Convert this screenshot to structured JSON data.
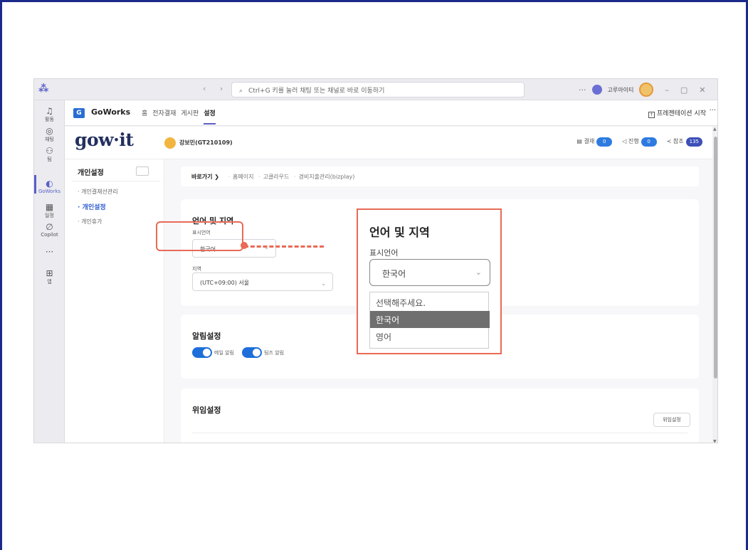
{
  "titlebar": {
    "search_placeholder": "Ctrl+G 키를 눌러 채팅 또는 채널로 바로 이동하기",
    "user_name": "고루아이티",
    "more": "···"
  },
  "rail": {
    "items": [
      {
        "icon": "bell-icon",
        "label": "활동"
      },
      {
        "icon": "chat-icon",
        "label": "채팅"
      },
      {
        "icon": "teams-icon",
        "label": "팀"
      },
      {
        "icon": "goworks-icon",
        "label": "GoWorks"
      },
      {
        "icon": "calendar-icon",
        "label": "일정"
      },
      {
        "icon": "copilot-icon",
        "label": "Copilot"
      },
      {
        "icon": "more-icon",
        "label": "···"
      },
      {
        "icon": "apps-icon",
        "label": "앱"
      }
    ]
  },
  "app_header": {
    "logo_letter": "G",
    "app_name": "GoWorks",
    "tabs": [
      "홈",
      "전자결재",
      "게시판",
      "설정"
    ],
    "active_tab": "설정",
    "present_label": "프레젠테이션 시작",
    "more": "···"
  },
  "gowit_header": {
    "logo": "gow·it",
    "user": "강보민(GT210109)",
    "stats": [
      {
        "label": "결재",
        "count": "0"
      },
      {
        "label": "진행",
        "count": "0"
      },
      {
        "label": "참조",
        "count": "135"
      }
    ]
  },
  "left_nav": {
    "title": "개인설정",
    "items": [
      "· 개인결재선관리",
      "· 개인설정",
      "· 개인휴가"
    ],
    "active": "· 개인설정"
  },
  "breadcrumb": {
    "lead": "바로가기 ❯",
    "items": [
      "홈페이지",
      "고클라우드",
      "경비지출관리(bizplay)"
    ]
  },
  "language_card": {
    "title": "언어 및 지역",
    "display_language_label": "표시언어",
    "display_language_value": "한국어",
    "region_label": "지역",
    "region_value": "(UTC+09:00) 서울"
  },
  "notification_card": {
    "title": "알림설정",
    "toggles": [
      {
        "label": "메일 알림",
        "on": true
      },
      {
        "label": "팀즈 알림",
        "on": true
      }
    ]
  },
  "delegation_card": {
    "title": "위임설정",
    "button": "위임설정"
  },
  "zoom": {
    "title": "언어 및 지역",
    "label": "표시언어",
    "value": "한국어",
    "options": [
      "선택해주세요.",
      "한국어",
      "영어"
    ],
    "selected": "한국어"
  },
  "colors": {
    "accent": "#5b5fc7",
    "highlight": "#e96a55",
    "toggle": "#1e6fd9",
    "frame": "#1b2a8a"
  }
}
